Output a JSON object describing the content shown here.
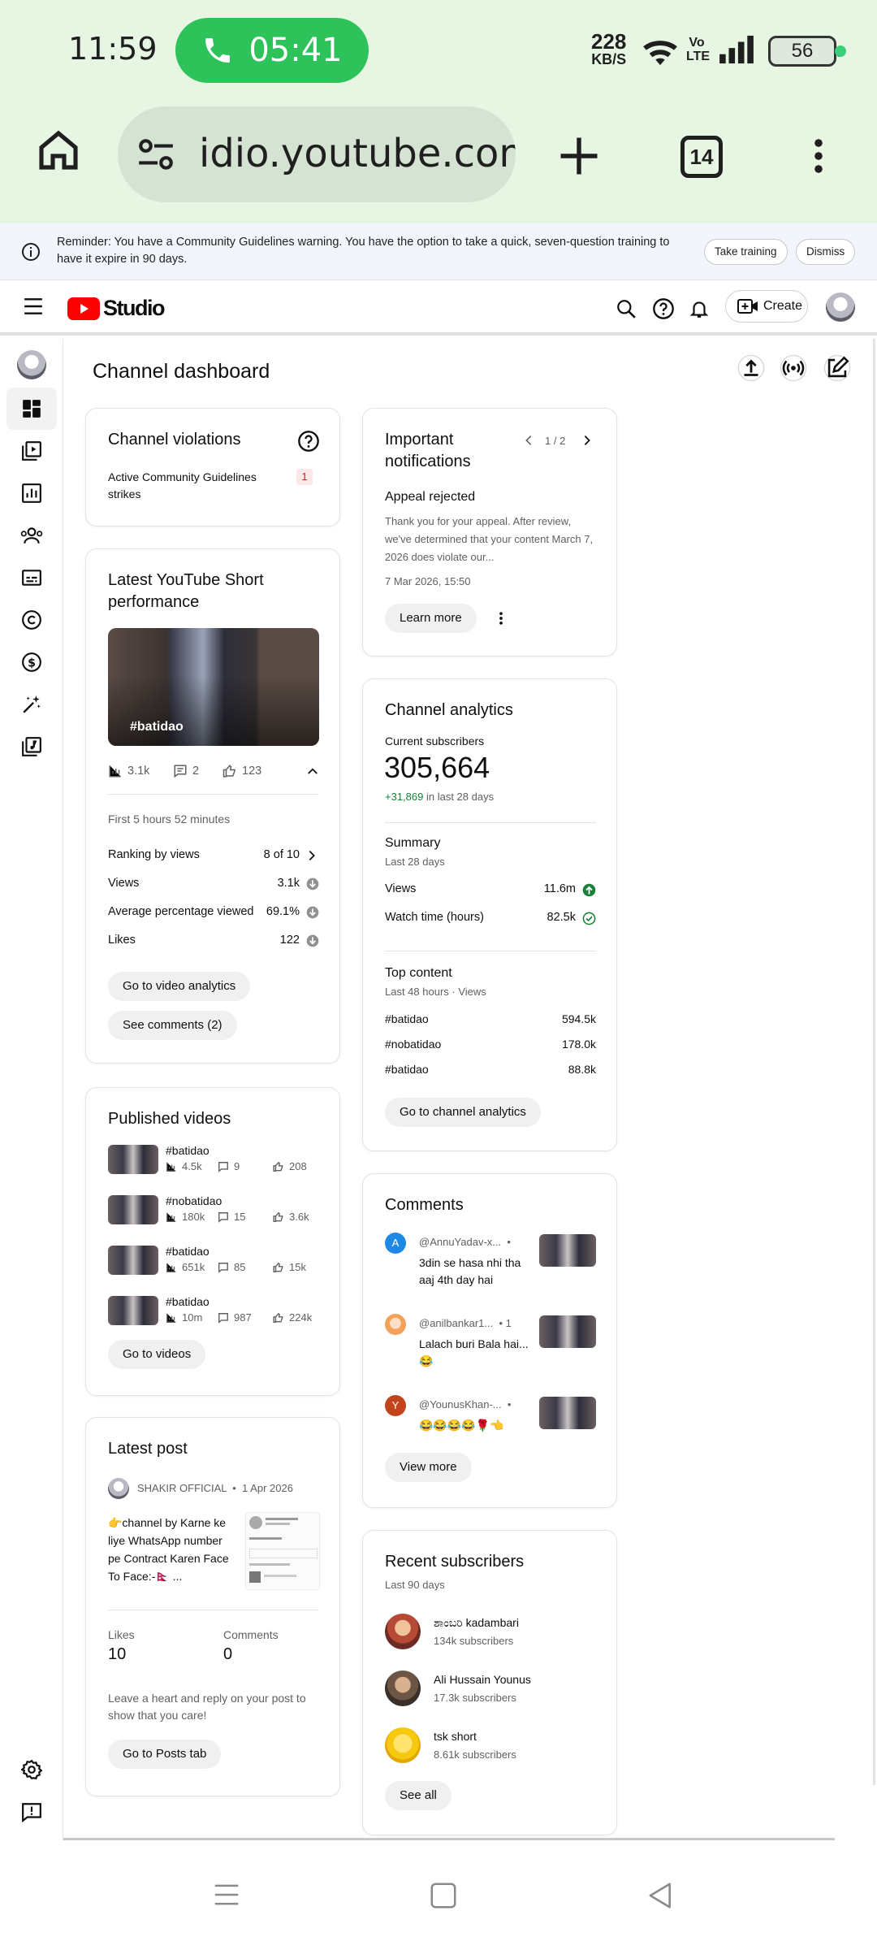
{
  "status_bar": {
    "time": "11:59",
    "call_timer": "05:41",
    "net_speed": "228",
    "net_unit": "KB/S",
    "volte": "Vo LTE",
    "battery": "56"
  },
  "browser": {
    "url": "idio.youtube.com",
    "tab_count": "14"
  },
  "banner": {
    "text": "Reminder: You have a Community Guidelines warning. You have the option to take a quick, seven-question training to have it expire in 90 days.",
    "take_training": "Take training",
    "dismiss": "Dismiss"
  },
  "header": {
    "logo_text": "Studio",
    "create_label": "Create"
  },
  "page": {
    "title": "Channel dashboard"
  },
  "violations": {
    "title": "Channel violations",
    "label": "Active Community Guidelines strikes",
    "count": "1"
  },
  "short_perf": {
    "title": "Latest YouTube Short performance",
    "thumb_caption": "#batidao",
    "views": "3.1k",
    "comments": "2",
    "likes": "123",
    "period": "First 5 hours 52 minutes",
    "rows": [
      {
        "label": "Ranking by views",
        "value": "8 of 10"
      },
      {
        "label": "Views",
        "value": "3.1k"
      },
      {
        "label": "Average percentage viewed",
        "value": "69.1%"
      },
      {
        "label": "Likes",
        "value": "122"
      }
    ],
    "btn_analytics": "Go to video analytics",
    "btn_comments": "See comments (2)"
  },
  "published": {
    "title": "Published videos",
    "videos": [
      {
        "title": "#batidao",
        "views": "4.5k",
        "comments": "9",
        "likes": "208"
      },
      {
        "title": "#nobatidao",
        "views": "180k",
        "comments": "15",
        "likes": "3.6k"
      },
      {
        "title": "#batidao",
        "views": "651k",
        "comments": "85",
        "likes": "15k"
      },
      {
        "title": "#batidao",
        "views": "10m",
        "comments": "987",
        "likes": "224k"
      }
    ],
    "btn": "Go to videos"
  },
  "latest_post": {
    "title": "Latest post",
    "author": "SHAKIR OFFICIAL",
    "date": "1 Apr 2026",
    "text": "👉channel by Karne ke liye WhatsApp number pe Contract Karen Face To Face:-🇳🇵 ...",
    "likes_label": "Likes",
    "likes": "10",
    "comments_label": "Comments",
    "comments": "0",
    "prompt": "Leave a heart and reply on your post to show that you care!",
    "btn": "Go to Posts tab"
  },
  "notifications": {
    "title": "Important notifications",
    "pager": "1 / 2",
    "item_title": "Appeal rejected",
    "item_text": "Thank you for your appeal. After review, we've determined that your content March 7, 2026 does violate our...",
    "item_date": "7 Mar 2026, 15:50",
    "btn": "Learn more"
  },
  "analytics": {
    "title": "Channel analytics",
    "subs_label": "Current subscribers",
    "subs": "305,664",
    "subs_delta": "+31,869",
    "subs_delta_suffix": " in last 28 days",
    "summary_title": "Summary",
    "summary_period": "Last 28 days",
    "summary_rows": [
      {
        "label": "Views",
        "value": "11.6m"
      },
      {
        "label": "Watch time (hours)",
        "value": "82.5k"
      }
    ],
    "top_title": "Top content",
    "top_period": "Last 48 hours · Views",
    "top_rows": [
      {
        "label": "#batidao",
        "value": "594.5k"
      },
      {
        "label": "#nobatidao",
        "value": "178.0k"
      },
      {
        "label": "#batidao",
        "value": "88.8k"
      }
    ],
    "btn": "Go to channel analytics"
  },
  "comments": {
    "title": "Comments",
    "items": [
      {
        "initial": "A",
        "color": "#1e88e5",
        "author": "@AnnuYadav-x...",
        "extra": "•",
        "text": "3din se hasa nhi tha aaj 4th day hai"
      },
      {
        "initial": "",
        "color": "#f4a259",
        "author": "@anilbankar1...",
        "extra": "• 1",
        "text": "Lalach buri Bala hai... 😂"
      },
      {
        "initial": "Y",
        "color": "#c2441c",
        "author": "@YounusKhan-...",
        "extra": "•",
        "text": "😂😂😂😂🌹👈"
      }
    ],
    "btn": "View more"
  },
  "recent_subs": {
    "title": "Recent subscribers",
    "period": "Last 90 days",
    "items": [
      {
        "name": "ಶಾಂಬರಿ kadambari",
        "subs": "134k subscribers"
      },
      {
        "name": "Ali Hussain Younus",
        "subs": "17.3k subscribers"
      },
      {
        "name": "tsk short",
        "subs": "8.61k subscribers"
      }
    ],
    "btn": "See all"
  },
  "icons": {
    "home": "home-icon",
    "tune": "site-settings-icon",
    "plus": "new-tab-icon",
    "more": "more-vert-icon",
    "info": "info-icon",
    "menu": "hamburger-menu-icon",
    "search": "search-icon",
    "help": "help-icon",
    "bell": "notifications-icon",
    "upload": "upload-icon",
    "live": "go-live-icon",
    "edit": "create-post-icon"
  },
  "colors": {
    "status_bg": "#e7f6e3",
    "call_green": "#2ec25a",
    "yt_red": "#ff0000",
    "positive_green": "#188038",
    "strike_bg": "#fde7e9"
  }
}
